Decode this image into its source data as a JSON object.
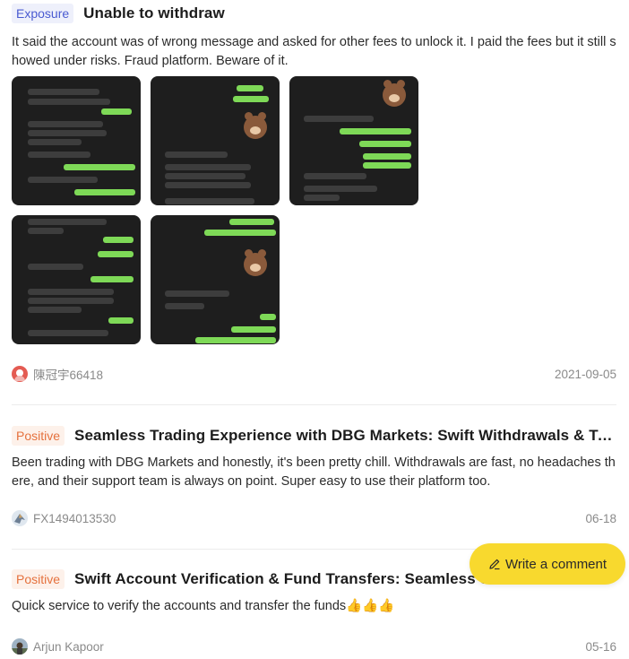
{
  "reviews": [
    {
      "tag": "Exposure",
      "title": "Unable to withdraw",
      "body": "It said the account was of wrong message and asked for other fees to unlock it. I paid the fees but it still showed under risks. Fraud platform. Beware of it.",
      "user": "陳冠宇66418",
      "date": "2021-09-05"
    },
    {
      "tag": "Positive",
      "title": "Seamless Trading Experience with DBG Markets: Swift Withdrawals & To...",
      "body": "Been trading with DBG Markets and honestly, it's been pretty chill. Withdrawals are fast, no headaches there, and their support team is always on point. Super easy to use their platform too.",
      "user": "FX1494013530",
      "date": "06-18"
    },
    {
      "tag": "Positive",
      "title": "Swift Account Verification & Fund Transfers: Seamless Service Exp...",
      "body": "Quick service to verify the accounts and transfer the funds👍👍👍",
      "user": "Arjun Kapoor",
      "date": "05-16"
    }
  ],
  "write_comment": {
    "label": "Write a comment"
  },
  "colors": {
    "exposure_tag": "#4a5bd1",
    "positive_tag": "#e5713d",
    "button_bg": "#f8d92e",
    "chat_green": "#7ed957"
  },
  "icons": {
    "edit": "pencil-icon"
  }
}
